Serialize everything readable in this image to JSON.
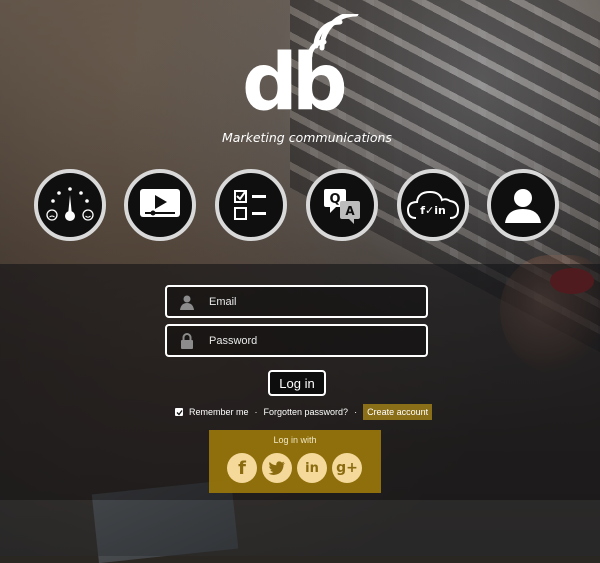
{
  "brand": {
    "logo_text": "db",
    "tagline": "Marketing communications"
  },
  "features": [
    {
      "icon": "dashboard-gauge-icon"
    },
    {
      "icon": "video-player-icon"
    },
    {
      "icon": "checklist-icon"
    },
    {
      "icon": "qa-chat-icon"
    },
    {
      "icon": "social-cloud-icon",
      "text": "f🐦in"
    },
    {
      "icon": "user-profile-icon"
    }
  ],
  "login": {
    "email_placeholder": "Email",
    "password_placeholder": "Password",
    "submit_label": "Log in",
    "remember_label": "Remember me",
    "separator": "·",
    "forgot_label": "Forgotten password?",
    "create_label": "Create account"
  },
  "social_login": {
    "title": "Log in with",
    "providers": [
      {
        "name": "facebook",
        "glyph": "f"
      },
      {
        "name": "twitter",
        "glyph": ""
      },
      {
        "name": "linkedin",
        "glyph": "in"
      },
      {
        "name": "google-plus",
        "glyph": "g+"
      }
    ]
  },
  "colors": {
    "accent_gold": "#98760a",
    "icon_gold": "#f4d99a",
    "create_button": "#8b6f18"
  }
}
